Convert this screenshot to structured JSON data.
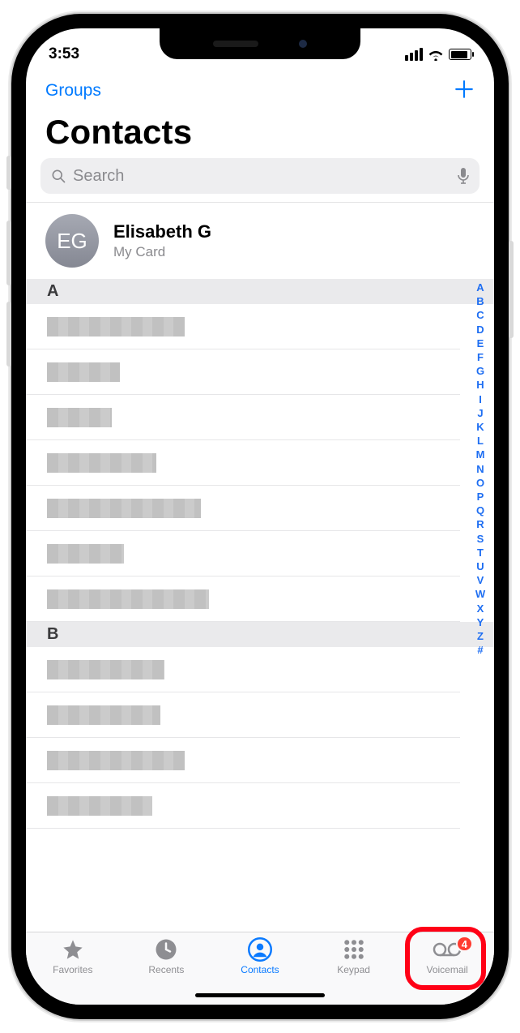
{
  "status": {
    "time": "3:53"
  },
  "nav": {
    "groups": "Groups"
  },
  "title": "Contacts",
  "search": {
    "placeholder": "Search"
  },
  "mycard": {
    "initials": "EG",
    "name": "Elisabeth G",
    "sub": "My Card"
  },
  "sections": [
    {
      "letter": "A",
      "rows": [
        170,
        90,
        80,
        135,
        190,
        95,
        200
      ]
    },
    {
      "letter": "B",
      "rows": [
        145,
        140,
        170,
        130
      ]
    }
  ],
  "index": [
    "A",
    "B",
    "C",
    "D",
    "E",
    "F",
    "G",
    "H",
    "I",
    "J",
    "K",
    "L",
    "M",
    "N",
    "O",
    "P",
    "Q",
    "R",
    "S",
    "T",
    "U",
    "V",
    "W",
    "X",
    "Y",
    "Z",
    "#"
  ],
  "tabs": {
    "items": [
      {
        "key": "favorites",
        "label": "Favorites"
      },
      {
        "key": "recents",
        "label": "Recents"
      },
      {
        "key": "contacts",
        "label": "Contacts",
        "active": true
      },
      {
        "key": "keypad",
        "label": "Keypad"
      },
      {
        "key": "voicemail",
        "label": "Voicemail",
        "badge": "4"
      }
    ]
  }
}
